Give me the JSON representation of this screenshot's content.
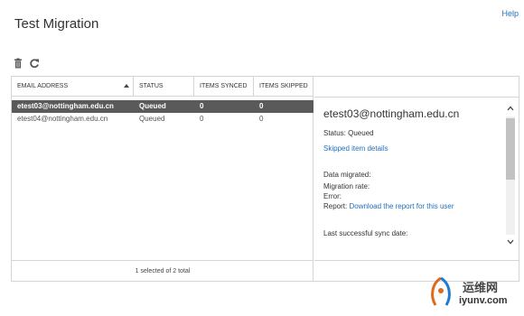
{
  "header": {
    "help_label": "Help",
    "title": "Test Migration"
  },
  "toolbar": {
    "icons": [
      "trash-icon",
      "refresh-icon"
    ]
  },
  "grid": {
    "columns": [
      "EMAIL ADDRESS",
      "STATUS",
      "ITEMS SYNCED",
      "ITEMS SKIPPED"
    ],
    "sort_column": "EMAIL ADDRESS",
    "rows": [
      {
        "email": "etest03@nottingham.edu.cn",
        "status": "Queued",
        "synced": "0",
        "skipped": "0",
        "selected": true
      },
      {
        "email": "etest04@nottingham.edu.cn",
        "status": "Queued",
        "synced": "0",
        "skipped": "0",
        "selected": false
      }
    ],
    "footer": "1 selected of 2 total"
  },
  "detail": {
    "email": "etest03@nottingham.edu.cn",
    "status_line": "Status: Queued",
    "skipped_link": "Skipped item details",
    "data_migrated": "Data migrated:",
    "migration_rate": "Migration rate:",
    "error": "Error:",
    "report_label": "Report:",
    "report_link": "Download the report for this user",
    "last_sync": "Last successful sync date:"
  },
  "watermark": {
    "brand_cn": "运维网",
    "url": "iyunv.com"
  },
  "colors": {
    "accent_link": "#1f6fbf",
    "selected_row": "#5a5a5a",
    "border": "#d4d4d4"
  }
}
